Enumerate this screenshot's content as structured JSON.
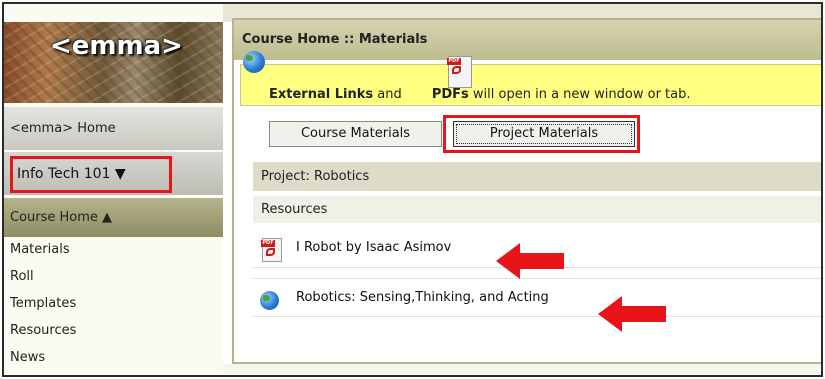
{
  "app": {
    "logo_text": "<emma>"
  },
  "sidebar": {
    "home_label": "<emma> Home",
    "course_selector": "Info Tech 101 ▼",
    "course_home": "Course Home ▲",
    "links": [
      "Materials",
      "Roll",
      "Templates",
      "Resources",
      "News"
    ]
  },
  "panel": {
    "header": "Course Home :: Materials",
    "notice": {
      "links_label": "External Links",
      "and_text": " and ",
      "pdfs_label": "PDFs",
      "rest_text": " will open in a new window or tab."
    },
    "tabs": [
      "Course Materials",
      "Project Materials"
    ],
    "project_title": "Project: Robotics",
    "resources_heading": "Resources",
    "resources": [
      {
        "type": "pdf",
        "title": "I Robot by Isaac Asimov"
      },
      {
        "type": "external-link",
        "title": "Robotics: Sensing,Thinking, and Acting"
      }
    ]
  },
  "colors": {
    "highlight": "#e8141a",
    "notice_bg": "#ffff80",
    "header_bg": "#c9c7a0",
    "sidebar_course_home_bg": "#a3a177"
  }
}
